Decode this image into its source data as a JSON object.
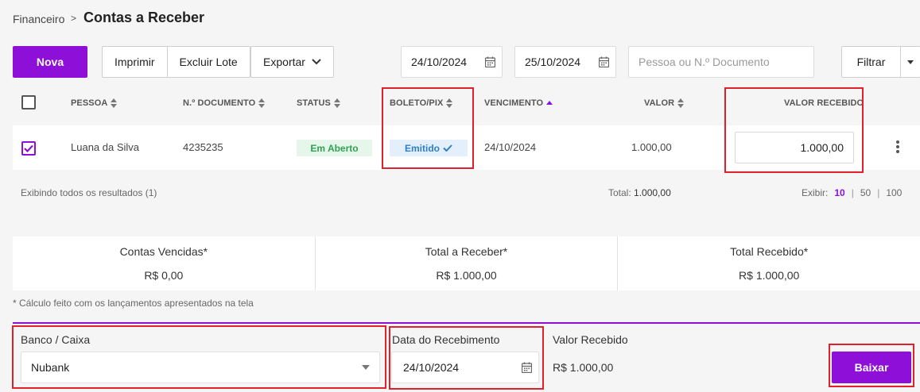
{
  "breadcrumb": {
    "root": "Financeiro",
    "separator": ">",
    "title": "Contas a Receber"
  },
  "toolbar": {
    "new_label": "Nova",
    "print_label": "Imprimir",
    "delete_batch_label": "Excluir Lote",
    "export_label": "Exportar",
    "date_from": "24/10/2024",
    "date_to": "25/10/2024",
    "search_placeholder": "Pessoa ou N.º Documento",
    "filter_label": "Filtrar"
  },
  "table": {
    "headers": {
      "person": "PESSOA",
      "document": "N.º DOCUMENTO",
      "status": "STATUS",
      "boleto": "BOLETO/PIX",
      "due": "VENCIMENTO",
      "value": "VALOR",
      "received": "VALOR RECEBIDO"
    },
    "rows": [
      {
        "person": "Luana da Silva",
        "document": "4235235",
        "status": "Em Aberto",
        "boleto": "Emitido",
        "due": "24/10/2024",
        "value": "1.000,00",
        "received": "1.000,00"
      }
    ],
    "showing_text": "Exibindo todos os resultados (1)",
    "total_label": "Total:",
    "total_value": "1.000,00",
    "pager_label": "Exibir:",
    "pager_options": [
      "10",
      "50",
      "100"
    ],
    "pager_selected": "10"
  },
  "summary": [
    {
      "label": "Contas Vencidas*",
      "value": "R$ 0,00"
    },
    {
      "label": "Total a Receber*",
      "value": "R$ 1.000,00"
    },
    {
      "label": "Total Recebido*",
      "value": "R$ 1.000,00"
    }
  ],
  "summary_note": "* Cálculo feito com os lançamentos apresentados na tela",
  "settlement": {
    "bank_label": "Banco / Caixa",
    "bank_value": "Nubank",
    "date_label": "Data do Recebimento",
    "date_value": "24/10/2024",
    "received_label": "Valor Recebido",
    "received_value": "R$ 1.000,00",
    "submit_label": "Baixar"
  },
  "colors": {
    "primary": "#8e0fd8",
    "highlight": "#e0202a",
    "status_open": "#2ea352",
    "boleto_emitido": "#2f7fc8"
  }
}
